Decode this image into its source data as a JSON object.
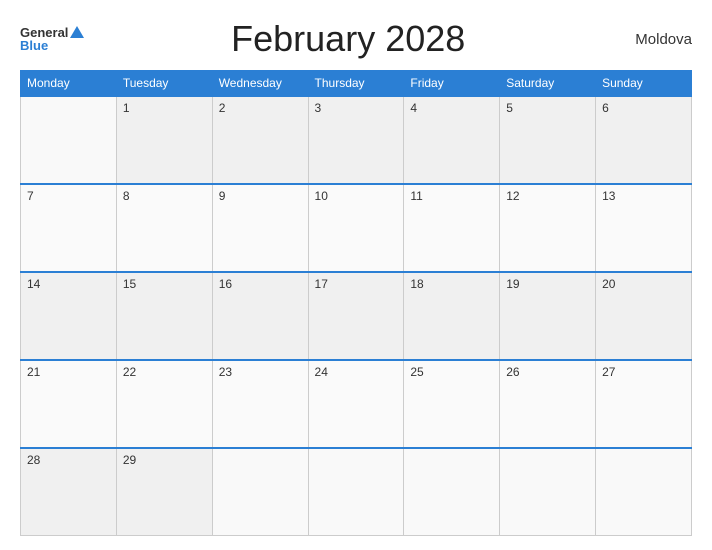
{
  "header": {
    "logo_general": "General",
    "logo_blue": "Blue",
    "title": "February 2028",
    "country": "Moldova"
  },
  "days": [
    "Monday",
    "Tuesday",
    "Wednesday",
    "Thursday",
    "Friday",
    "Saturday",
    "Sunday"
  ],
  "weeks": [
    [
      "",
      "1",
      "2",
      "3",
      "4",
      "5",
      "6"
    ],
    [
      "7",
      "8",
      "9",
      "10",
      "11",
      "12",
      "13"
    ],
    [
      "14",
      "15",
      "16",
      "17",
      "18",
      "19",
      "20"
    ],
    [
      "21",
      "22",
      "23",
      "24",
      "25",
      "26",
      "27"
    ],
    [
      "28",
      "29",
      "",
      "",
      "",
      "",
      ""
    ]
  ]
}
